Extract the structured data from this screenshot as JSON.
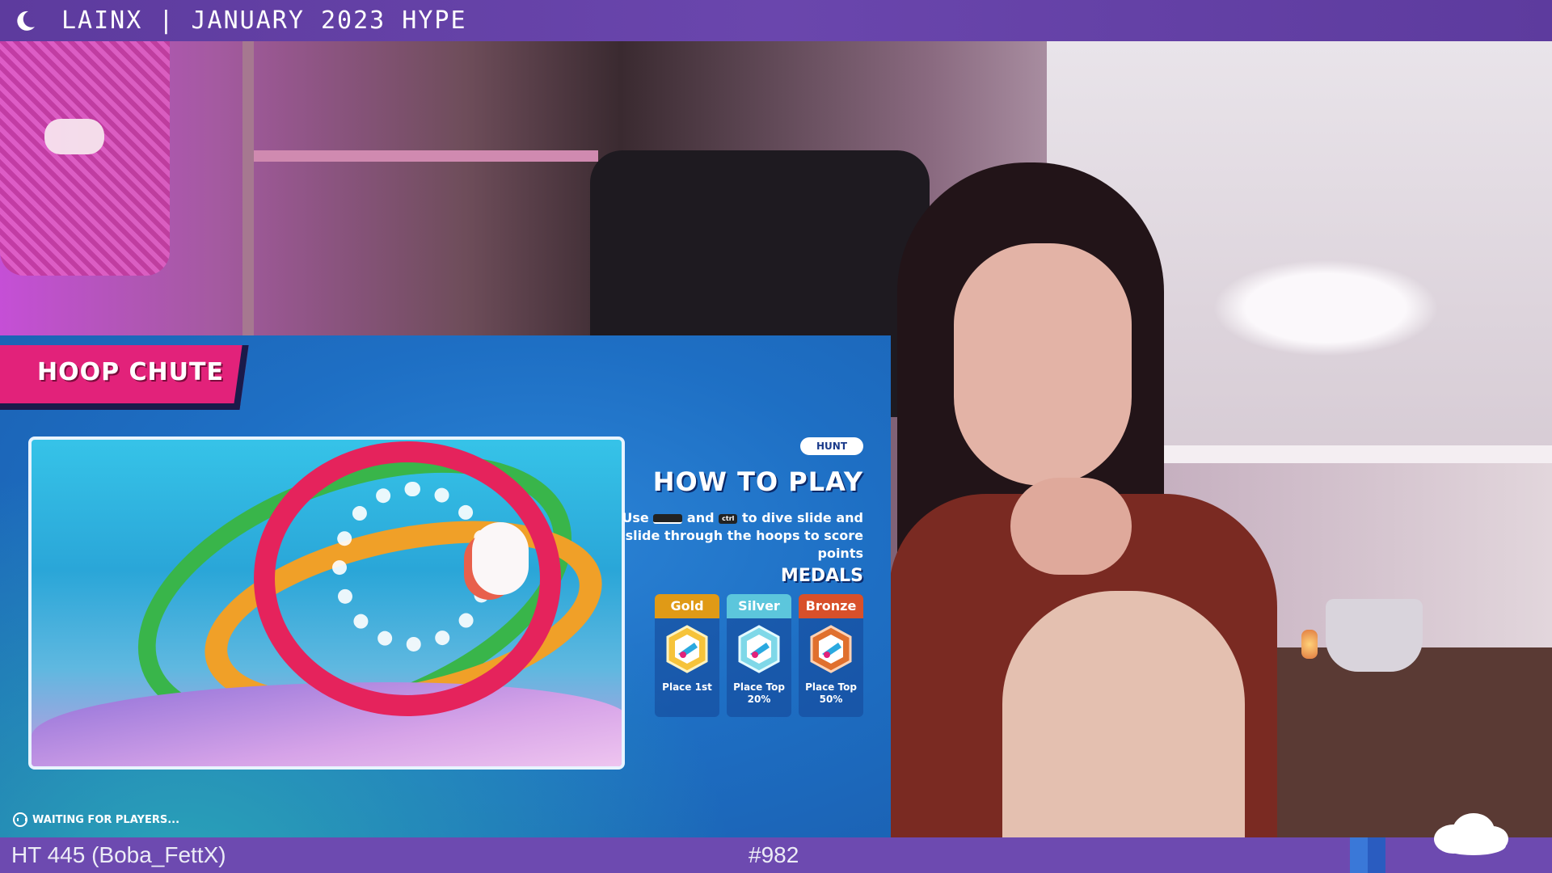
{
  "topbar": {
    "icon": "crescent-moon-icon",
    "title": "LAINX | JANUARY 2023 HYPE"
  },
  "game": {
    "title": "HOOP CHUTE",
    "mode_badge": "HUNT",
    "how_to_play_title": "HOW TO PLAY",
    "description": {
      "part1": "Use",
      "key1": "␣",
      "part2": "and",
      "key2": "ctrl",
      "part3": "to dive slide and slide through the hoops to score points"
    },
    "medals_title": "MEDALS",
    "medals": [
      {
        "name": "Gold",
        "label": "Place 1st",
        "color": "#e09a16"
      },
      {
        "name": "Silver",
        "label": "Place Top 20%",
        "color": "#5cc6dc"
      },
      {
        "name": "Bronze",
        "label": "Place Top 50%",
        "color": "#d8502a"
      }
    ],
    "status": "WAITING FOR PLAYERS..."
  },
  "bottombar": {
    "left_text": "HT 445 (Boba_FettX)",
    "center_text": "#982"
  },
  "colors": {
    "topbar": "#6a46ad",
    "bottombar": "#6d4ab0",
    "title_banner": "#e2227a"
  }
}
